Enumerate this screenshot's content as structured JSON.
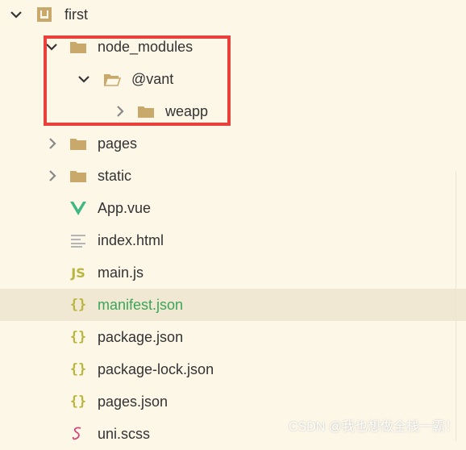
{
  "explorer": {
    "items": [
      {
        "label": "first",
        "type": "project",
        "chevron": "expanded",
        "icon": "project-folder-icon"
      },
      {
        "label": "node_modules",
        "type": "folder",
        "chevron": "expanded",
        "icon": "folder-icon"
      },
      {
        "label": "@vant",
        "type": "folder",
        "chevron": "expanded",
        "icon": "folder-open-icon"
      },
      {
        "label": "weapp",
        "type": "folder",
        "chevron": "collapsed",
        "icon": "folder-icon"
      },
      {
        "label": "pages",
        "type": "folder",
        "chevron": "collapsed",
        "icon": "folder-icon"
      },
      {
        "label": "static",
        "type": "folder",
        "chevron": "collapsed",
        "icon": "folder-icon"
      },
      {
        "label": "App.vue",
        "type": "file",
        "icon": "vue-icon"
      },
      {
        "label": "index.html",
        "type": "file",
        "icon": "html-file-icon"
      },
      {
        "label": "main.js",
        "type": "file",
        "icon": "js-icon",
        "glyph": "JS"
      },
      {
        "label": "manifest.json",
        "type": "file",
        "icon": "json-icon",
        "glyph": "{}",
        "selected": true
      },
      {
        "label": "package.json",
        "type": "file",
        "icon": "json-icon",
        "glyph": "{}"
      },
      {
        "label": "package-lock.json",
        "type": "file",
        "icon": "json-icon",
        "glyph": "{}"
      },
      {
        "label": "pages.json",
        "type": "file",
        "icon": "json-icon",
        "glyph": "{}"
      },
      {
        "label": "uni.scss",
        "type": "file",
        "icon": "scss-icon"
      }
    ]
  },
  "colors": {
    "background": "#fdf7e8",
    "folder": "#c9a96b",
    "vue": "#41b883",
    "json": "#b9b53d",
    "selected_text": "#3aa55a",
    "highlight_box": "#e9403c",
    "scss": "#d6457a"
  },
  "watermark": "CSDN @我也想做全栈一霸！"
}
